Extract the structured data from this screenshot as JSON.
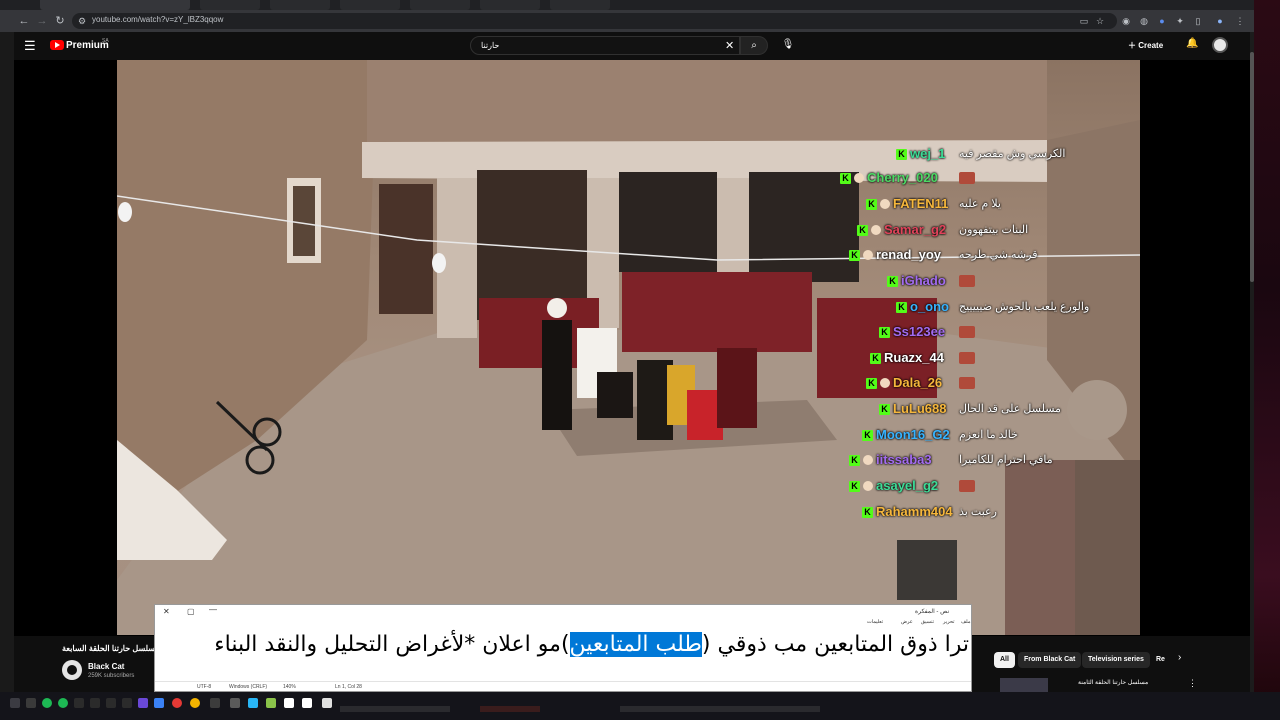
{
  "browser": {
    "url": "youtube.com/watch?v=zY_lBZ3qqow"
  },
  "masthead": {
    "brand": "Premium",
    "brand_sup": "SA",
    "search_value": "حارتنا",
    "create_label": "Create"
  },
  "chat": {
    "messages": [
      {
        "user": "wej_1",
        "message": "الكرسي وش مقصر فيه",
        "color": "#3ddc97"
      },
      {
        "user": "Cherry_020",
        "message": "",
        "color": "#4cd964"
      },
      {
        "user": "FATEN11",
        "message": "يلا م عليه",
        "color": "#f6b73c"
      },
      {
        "user": "Samar_g2",
        "message": "البنات بيتفهوون",
        "color": "#e0435a"
      },
      {
        "user": "renad_yoy",
        "message": "قرشه شي طرحه",
        "color": "#ffffff"
      },
      {
        "user": "iGhado",
        "message": "",
        "color": "#a36bf0"
      },
      {
        "user": "o_ono",
        "message": "والورع يلعب بالحوش ضيييييج",
        "color": "#36b3ff"
      },
      {
        "user": "Ss123ee",
        "message": "",
        "color": "#a36bf0"
      },
      {
        "user": "Ruazx_44",
        "message": "",
        "color": "#ffffff"
      },
      {
        "user": "Dala_26",
        "message": "",
        "color": "#f6b73c"
      },
      {
        "user": "LuLu688",
        "message": "مسلسل على قد الحال",
        "color": "#f6b73c"
      },
      {
        "user": "Moon16_G2",
        "message": "خالد ما انعزم",
        "color": "#36b3ff"
      },
      {
        "user": "iitssaba3",
        "message": "مافي احترام للكاميرا",
        "color": "#a36bf0"
      },
      {
        "user": "asayel_g2",
        "message": "",
        "color": "#3ddc97"
      },
      {
        "user": "Rahamm404",
        "message": "رعبت بذ",
        "color": "#f6b73c"
      }
    ]
  },
  "video_info": {
    "title": "مسلسل حارتنا الحلقة السابعة",
    "channel": "Black Cat",
    "subscribers": "259K subscribers"
  },
  "chips": [
    "All",
    "From Black Cat",
    "Television series",
    "Re"
  ],
  "recommendation": {
    "title": "مسلسل حارتنا الحلقة الثامنة"
  },
  "notepad": {
    "title": "نص - المفكرة",
    "menu": [
      "ملف",
      "تحرير",
      "تنسيق",
      "عرض",
      "تعليمات"
    ],
    "text_before": "ترا ذوق المتابعين مب ذوقي (",
    "text_selected": "طلب المتابعين",
    "text_after": ")مو اعلان *لأغراض التحليل والنقد البناء",
    "status_encoding": "UTF-8",
    "status_eol": "Windows (CRLF)",
    "status_zoom": "140%",
    "status_pos": "Ln 1, Col 28"
  }
}
